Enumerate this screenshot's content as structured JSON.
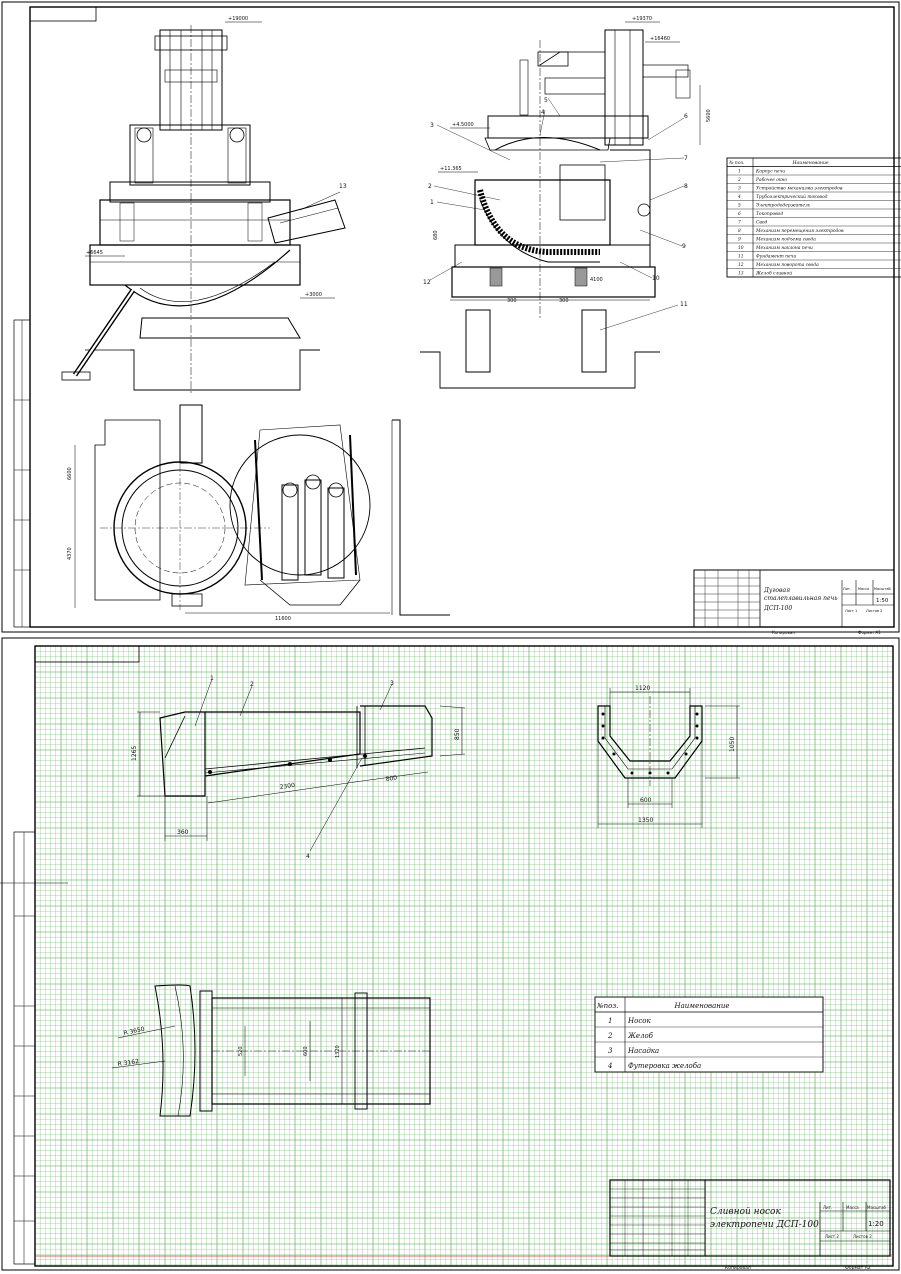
{
  "sheet1": {
    "dimensions": {
      "elev_top_left": "+19000",
      "elev_left_mid": "+6645",
      "elev_left_base": "+3000",
      "elev_right_top": "+19370",
      "elev_right_top2": "+16460",
      "elev_right_roof": "+4.5000",
      "elev_right_shell": "+11.365",
      "dim_vertical_right": "5600",
      "dim_left_small": "680",
      "dim_base_1": "300",
      "dim_base_2": "300",
      "dim_base_3": "4100",
      "plan_dim_v1": "6600",
      "plan_dim_v2": "4370",
      "plan_dim_h": "11600"
    },
    "callouts": [
      "1",
      "2",
      "3",
      "4",
      "5",
      "6",
      "7",
      "8",
      "9",
      "10",
      "11",
      "12",
      "13"
    ],
    "parts_table": {
      "header_no": "№ поз.",
      "header_name": "Наименование",
      "rows": [
        {
          "no": "1",
          "name": "Корпус печи"
        },
        {
          "no": "2",
          "name": "Рабочее окно"
        },
        {
          "no": "3",
          "name": "Устройство механизма электродов"
        },
        {
          "no": "4",
          "name": "Трубоэлектрический токовод"
        },
        {
          "no": "5",
          "name": "Электрододержатель"
        },
        {
          "no": "6",
          "name": "Токопровод"
        },
        {
          "no": "7",
          "name": "Свод"
        },
        {
          "no": "8",
          "name": "Механизм перемещения электродов"
        },
        {
          "no": "9",
          "name": "Механизм подъема свода"
        },
        {
          "no": "10",
          "name": "Механизм наклона печи"
        },
        {
          "no": "11",
          "name": "Фундамент печи"
        },
        {
          "no": "12",
          "name": "Механизм поворота свода"
        },
        {
          "no": "13",
          "name": "Желоб сливной"
        }
      ]
    },
    "title_block": {
      "title_line1": "Дуговая",
      "title_line2": "сталеплавильная печь",
      "title_line3": "ДСП-100",
      "scale": "1:50",
      "col_lit": "Лит.",
      "col_mass": "Масса",
      "col_scale": "Масштаб",
      "sheet": "Лист 1",
      "sheets": "Листов 2",
      "copied": "Копировал",
      "format": "Формат А1"
    }
  },
  "sheet2": {
    "dimensions": {
      "d_1265": "1265",
      "d_850": "850",
      "d_2300": "2300",
      "d_800": "800",
      "d_360": "360",
      "d_1120": "1120",
      "d_1050": "1050",
      "d_600": "600",
      "d_1350": "1350",
      "d_r3650": "R 3650",
      "d_r3162": "R 3162",
      "d_520": "520",
      "d_600b": "600",
      "d_1320": "1320"
    },
    "callouts": [
      "1",
      "2",
      "3",
      "4"
    ],
    "parts_table": {
      "header_no": "№поз.",
      "header_name": "Наименование",
      "rows": [
        {
          "no": "1",
          "name": "Носок"
        },
        {
          "no": "2",
          "name": "Желоб"
        },
        {
          "no": "3",
          "name": "Насадка"
        },
        {
          "no": "4",
          "name": "Футеровка желоба"
        }
      ]
    },
    "title_block": {
      "title_line1": "Сливной носок",
      "title_line2": "электропечи ДСП-100",
      "scale": "1:20",
      "col_lit": "Лит.",
      "col_mass": "Масса",
      "col_scale": "Масштаб",
      "sheet": "Лист 2",
      "sheets": "Листов 2",
      "copied": "Копировал",
      "format": "Формат А2"
    }
  }
}
